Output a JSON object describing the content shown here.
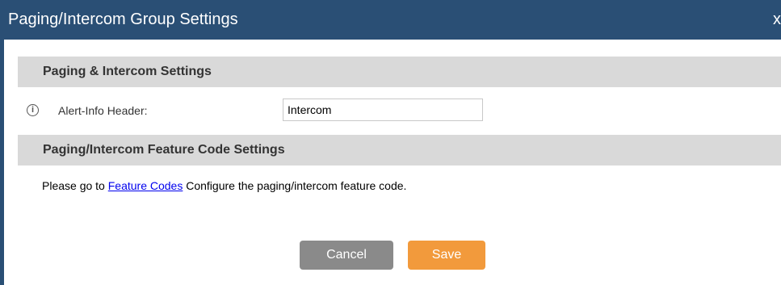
{
  "dialog": {
    "title": "Paging/Intercom Group Settings",
    "close_label": "x"
  },
  "sections": [
    {
      "title": "Paging & Intercom Settings"
    },
    {
      "title": "Paging/Intercom Feature Code Settings"
    }
  ],
  "alert_info": {
    "icon": "i",
    "label": "Alert-Info Header:",
    "value": "Intercom"
  },
  "feature_code_note": {
    "prefix": "Please go to ",
    "link_text": "Feature Codes",
    "suffix": " Configure the paging/intercom feature code."
  },
  "buttons": {
    "cancel": "Cancel",
    "save": "Save"
  },
  "colors": {
    "titlebar": "#2a4f75",
    "section_header": "#d9d9d9",
    "cancel_button": "#8a8a8a",
    "save_button": "#f29a3c",
    "link": "#0000ee"
  }
}
